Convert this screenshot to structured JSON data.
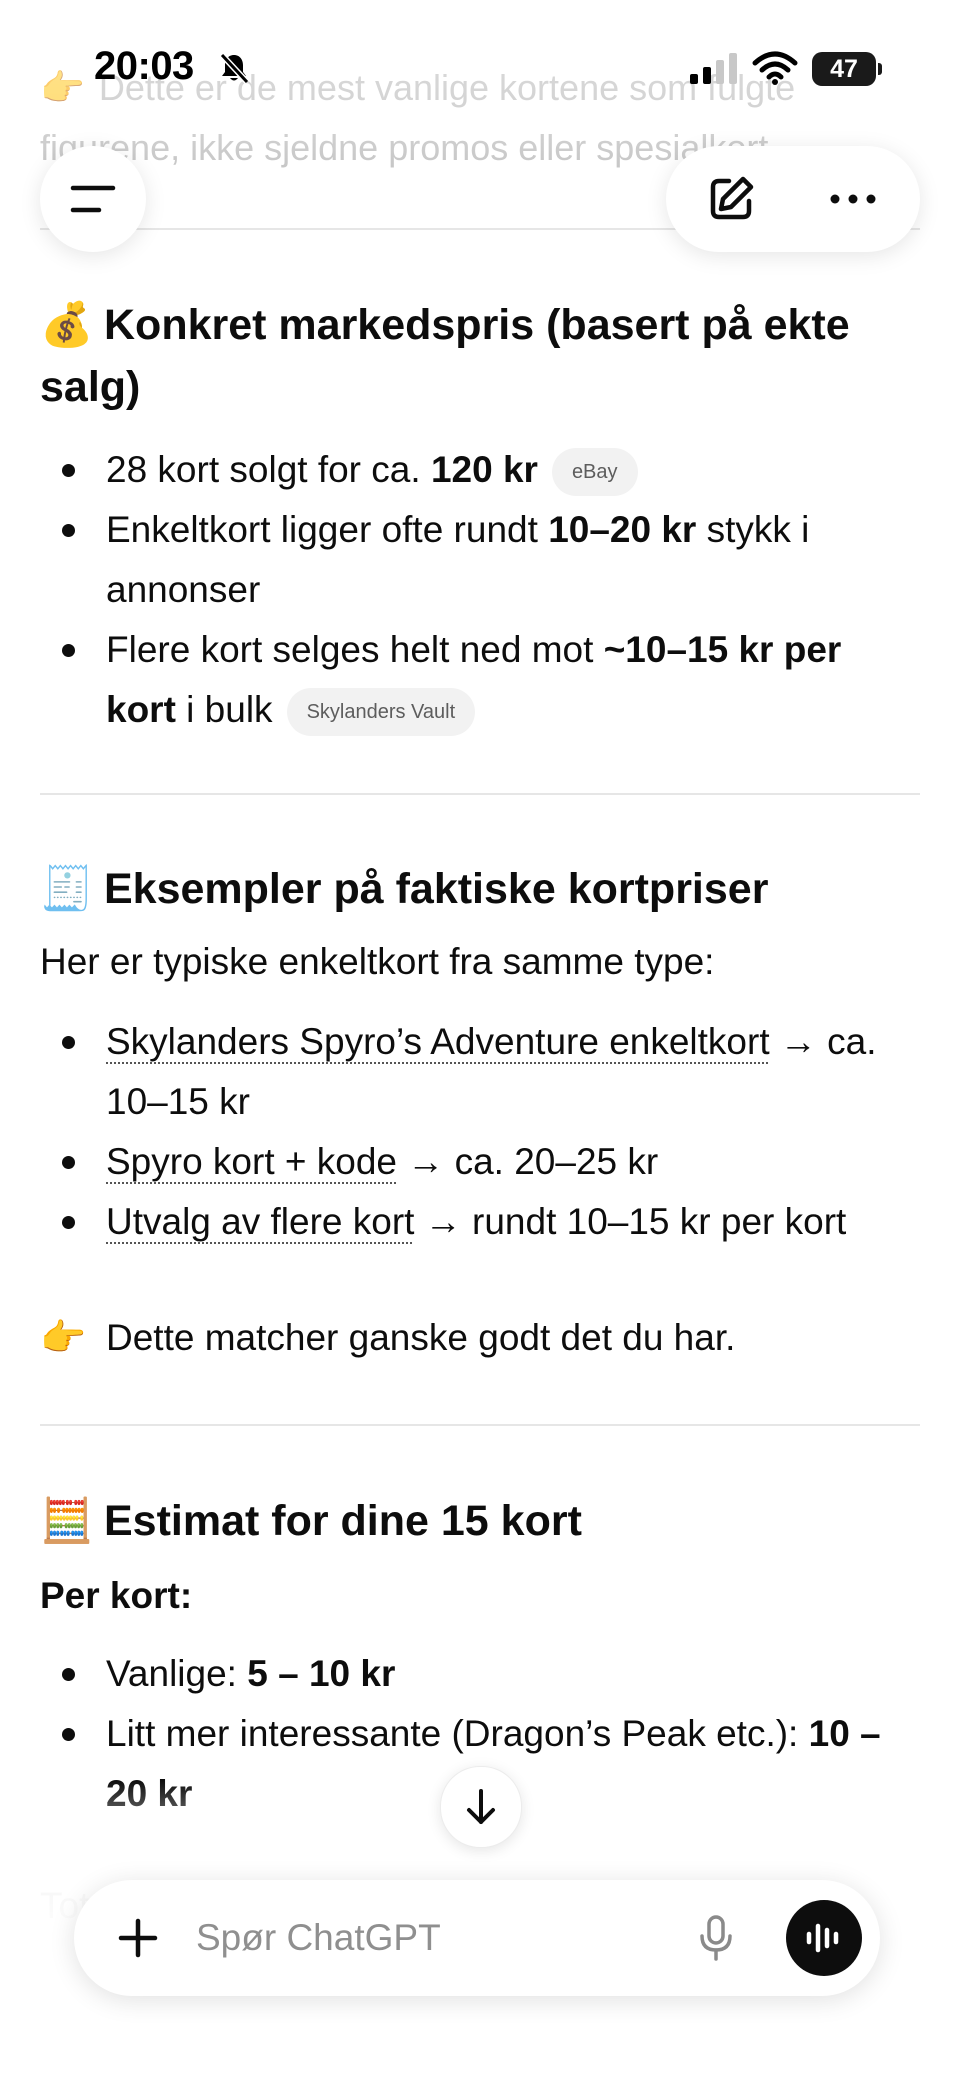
{
  "status_bar": {
    "time": "20:03",
    "battery": "47"
  },
  "top_fade_text": {
    "emoji": "👉",
    "text": "Dette er de mest vanlige kortene som fulgte figurene, ikke sjeldne promos eller spesialkort."
  },
  "sections": {
    "market": {
      "emoji": "💰",
      "title": "Konkret markedspris (basert på ekte salg)",
      "items": [
        {
          "pre": "28 kort solgt for ca. ",
          "bold": "120 kr",
          "post": "",
          "chip": "eBay"
        },
        {
          "pre": "Enkeltkort ligger ofte rundt ",
          "bold": "10–20 kr",
          "post": " stykk i annonser"
        },
        {
          "pre": "Flere kort selges helt ned mot ",
          "bold": "~10–15 kr per kort",
          "post": " i bulk",
          "chip": "Skylanders Vault"
        }
      ]
    },
    "examples": {
      "emoji": "🧾",
      "title": "Eksempler på faktiske kortpriser",
      "intro": "Her er typiske enkeltkort fra samme type:",
      "items": [
        {
          "link": "Skylanders Spyro’s Adventure enkeltkort",
          "rest": " → ca. 10–15 kr"
        },
        {
          "link": "Spyro kort + kode",
          "rest": " → ca. 20–25 kr"
        },
        {
          "link": "Utvalg av flere kort",
          "rest": " → rundt 10–15 kr per kort"
        }
      ],
      "pointer_emoji": "👉",
      "pointer_text": "Dette matcher ganske godt det du har."
    },
    "estimate": {
      "emoji": "🧮",
      "title": "Estimat for dine 15 kort",
      "subheading": "Per kort:",
      "items": [
        {
          "pre": "Vanlige: ",
          "bold": "5 – 10 kr"
        },
        {
          "pre": "Litt mer interessante (Dragon’s Peak etc.): ",
          "bold": "10 – 20 kr"
        }
      ]
    }
  },
  "bottom_fade_text": "Tot",
  "composer": {
    "placeholder": "Spør ChatGPT"
  }
}
